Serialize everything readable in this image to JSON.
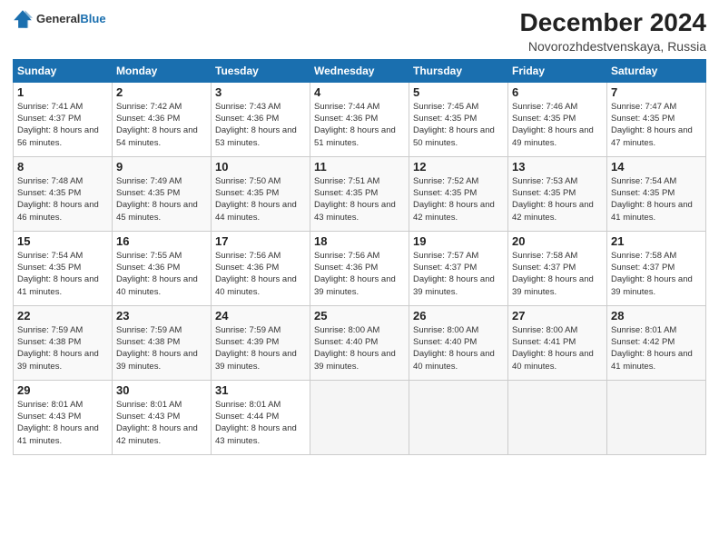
{
  "header": {
    "logo_general": "General",
    "logo_blue": "Blue",
    "month_title": "December 2024",
    "location": "Novorozhdestvenskaya, Russia"
  },
  "days_of_week": [
    "Sunday",
    "Monday",
    "Tuesday",
    "Wednesday",
    "Thursday",
    "Friday",
    "Saturday"
  ],
  "weeks": [
    [
      {
        "day": 1,
        "sunrise": "7:41 AM",
        "sunset": "4:37 PM",
        "daylight": "8 hours and 56 minutes."
      },
      {
        "day": 2,
        "sunrise": "7:42 AM",
        "sunset": "4:36 PM",
        "daylight": "8 hours and 54 minutes."
      },
      {
        "day": 3,
        "sunrise": "7:43 AM",
        "sunset": "4:36 PM",
        "daylight": "8 hours and 53 minutes."
      },
      {
        "day": 4,
        "sunrise": "7:44 AM",
        "sunset": "4:36 PM",
        "daylight": "8 hours and 51 minutes."
      },
      {
        "day": 5,
        "sunrise": "7:45 AM",
        "sunset": "4:35 PM",
        "daylight": "8 hours and 50 minutes."
      },
      {
        "day": 6,
        "sunrise": "7:46 AM",
        "sunset": "4:35 PM",
        "daylight": "8 hours and 49 minutes."
      },
      {
        "day": 7,
        "sunrise": "7:47 AM",
        "sunset": "4:35 PM",
        "daylight": "8 hours and 47 minutes."
      }
    ],
    [
      {
        "day": 8,
        "sunrise": "7:48 AM",
        "sunset": "4:35 PM",
        "daylight": "8 hours and 46 minutes."
      },
      {
        "day": 9,
        "sunrise": "7:49 AM",
        "sunset": "4:35 PM",
        "daylight": "8 hours and 45 minutes."
      },
      {
        "day": 10,
        "sunrise": "7:50 AM",
        "sunset": "4:35 PM",
        "daylight": "8 hours and 44 minutes."
      },
      {
        "day": 11,
        "sunrise": "7:51 AM",
        "sunset": "4:35 PM",
        "daylight": "8 hours and 43 minutes."
      },
      {
        "day": 12,
        "sunrise": "7:52 AM",
        "sunset": "4:35 PM",
        "daylight": "8 hours and 42 minutes."
      },
      {
        "day": 13,
        "sunrise": "7:53 AM",
        "sunset": "4:35 PM",
        "daylight": "8 hours and 42 minutes."
      },
      {
        "day": 14,
        "sunrise": "7:54 AM",
        "sunset": "4:35 PM",
        "daylight": "8 hours and 41 minutes."
      }
    ],
    [
      {
        "day": 15,
        "sunrise": "7:54 AM",
        "sunset": "4:35 PM",
        "daylight": "8 hours and 41 minutes."
      },
      {
        "day": 16,
        "sunrise": "7:55 AM",
        "sunset": "4:36 PM",
        "daylight": "8 hours and 40 minutes."
      },
      {
        "day": 17,
        "sunrise": "7:56 AM",
        "sunset": "4:36 PM",
        "daylight": "8 hours and 40 minutes."
      },
      {
        "day": 18,
        "sunrise": "7:56 AM",
        "sunset": "4:36 PM",
        "daylight": "8 hours and 39 minutes."
      },
      {
        "day": 19,
        "sunrise": "7:57 AM",
        "sunset": "4:37 PM",
        "daylight": "8 hours and 39 minutes."
      },
      {
        "day": 20,
        "sunrise": "7:58 AM",
        "sunset": "4:37 PM",
        "daylight": "8 hours and 39 minutes."
      },
      {
        "day": 21,
        "sunrise": "7:58 AM",
        "sunset": "4:37 PM",
        "daylight": "8 hours and 39 minutes."
      }
    ],
    [
      {
        "day": 22,
        "sunrise": "7:59 AM",
        "sunset": "4:38 PM",
        "daylight": "8 hours and 39 minutes."
      },
      {
        "day": 23,
        "sunrise": "7:59 AM",
        "sunset": "4:38 PM",
        "daylight": "8 hours and 39 minutes."
      },
      {
        "day": 24,
        "sunrise": "7:59 AM",
        "sunset": "4:39 PM",
        "daylight": "8 hours and 39 minutes."
      },
      {
        "day": 25,
        "sunrise": "8:00 AM",
        "sunset": "4:40 PM",
        "daylight": "8 hours and 39 minutes."
      },
      {
        "day": 26,
        "sunrise": "8:00 AM",
        "sunset": "4:40 PM",
        "daylight": "8 hours and 40 minutes."
      },
      {
        "day": 27,
        "sunrise": "8:00 AM",
        "sunset": "4:41 PM",
        "daylight": "8 hours and 40 minutes."
      },
      {
        "day": 28,
        "sunrise": "8:01 AM",
        "sunset": "4:42 PM",
        "daylight": "8 hours and 41 minutes."
      }
    ],
    [
      {
        "day": 29,
        "sunrise": "8:01 AM",
        "sunset": "4:43 PM",
        "daylight": "8 hours and 41 minutes."
      },
      {
        "day": 30,
        "sunrise": "8:01 AM",
        "sunset": "4:43 PM",
        "daylight": "8 hours and 42 minutes."
      },
      {
        "day": 31,
        "sunrise": "8:01 AM",
        "sunset": "4:44 PM",
        "daylight": "8 hours and 43 minutes."
      },
      null,
      null,
      null,
      null
    ]
  ]
}
